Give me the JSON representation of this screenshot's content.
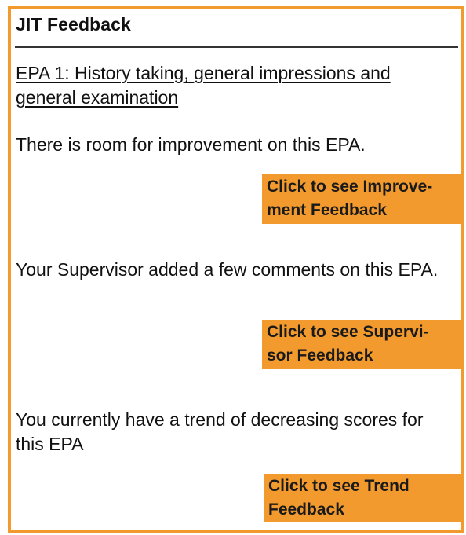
{
  "panel": {
    "title": "JIT Feedback",
    "epa_title": "EPA 1: History taking, general impressions and general examination"
  },
  "sections": [
    {
      "message": "There is room for improvement on this EPA.",
      "button_label": "Click to see Improve-\nment Feedback"
    },
    {
      "message": "Your Supervisor added a few comments on this EPA.",
      "button_label": "Click to see Supervi-\nsor Feedback"
    },
    {
      "message": "You currently have a trend of decreasing scores for this EPA",
      "button_label": "Click to see Trend\nFeedback"
    }
  ],
  "colors": {
    "accent": "#f29a2e",
    "text": "#111111",
    "rule": "#333333"
  }
}
